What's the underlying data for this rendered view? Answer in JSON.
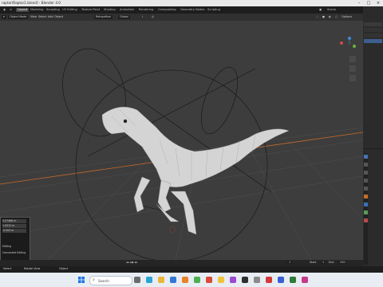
{
  "window": {
    "title": "raptor\\Raptor1.blend] - Blender 4.0"
  },
  "workspaces": [
    "Layout",
    "Modeling",
    "Sculpting",
    "UV Editing",
    "Texture Paint",
    "Shading",
    "Animation",
    "Rendering",
    "Compositing",
    "Geometry Nodes",
    "Scripting"
  ],
  "active_workspace": "Layout",
  "header": {
    "mode": "Object Mode",
    "menus": [
      "View",
      "Select",
      "Add",
      "Object"
    ],
    "orientation": "Global",
    "pivot": "Retopoflow"
  },
  "scene": {
    "name": "Scene"
  },
  "options_label": "Options",
  "timeline": {
    "current_frame": "1",
    "start_label": "Start",
    "start": "1",
    "end_label": "End",
    "end": "250"
  },
  "status_left": "Select",
  "status_mid": "Rotate View",
  "status_mid2": "Object",
  "last_operator": {
    "title": "",
    "rows": [
      "0.07468 m",
      "1.0012 m",
      "-0.003 m"
    ],
    "opt1": "Editing",
    "opt2": "Connected Editing"
  },
  "taskbar": {
    "search_placeholder": "Search"
  },
  "colors": {
    "accent": "#e08a2e",
    "grid": "#505050",
    "mesh": "#d9d9d9",
    "active_tab": "#4772b3"
  }
}
